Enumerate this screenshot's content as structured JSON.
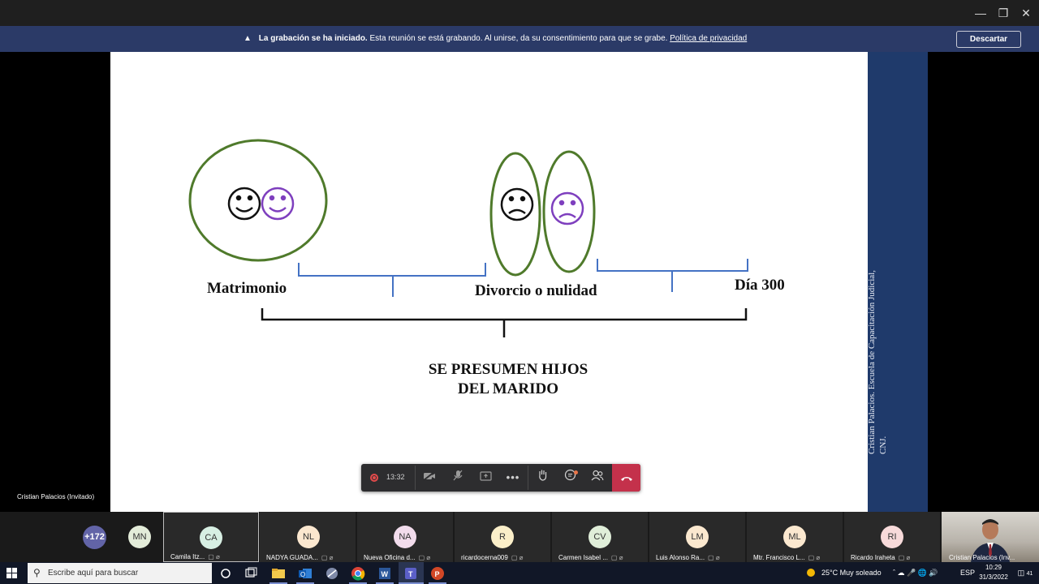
{
  "banner": {
    "title": "La grabación se ha iniciado.",
    "message": "Esta reunión se está grabando. Al unirse, da su consentimiento para que se grabe.",
    "link": "Política de privacidad",
    "dismiss": "Descartar"
  },
  "slide": {
    "label_marriage": "Matrimonio",
    "label_divorce": "Divorcio o nulidad",
    "label_day": "Día 300",
    "conclusion_line1": "SE PRESUMEN HIJOS",
    "conclusion_line2": "DEL MARIDO",
    "side_line1": "Cristian Palacios. Escuela de Capacitación Judicial,",
    "side_line2": "CNJ."
  },
  "presenter_label": "Cristian Palacios (Invitado)",
  "controls": {
    "timer": "13:32"
  },
  "participants": {
    "overflow": "+172",
    "tiles": [
      {
        "initials": "MN",
        "name": "",
        "color": "#e3ecd9"
      },
      {
        "initials": "CA",
        "name": "Camila Itz...",
        "color": "#d7efe3"
      },
      {
        "initials": "NL",
        "name": "NADYA GUADA...",
        "color": "#fbe7cf"
      },
      {
        "initials": "NA",
        "name": "Nueva Oficina d...",
        "color": "#f2dcec"
      },
      {
        "initials": "R",
        "name": "ricardocerna009",
        "color": "#fbefc9"
      },
      {
        "initials": "CV",
        "name": "Carmen Isabel ...",
        "color": "#e0eed9"
      },
      {
        "initials": "LM",
        "name": "Luis Alonso Ra...",
        "color": "#fbe8cf"
      },
      {
        "initials": "ML",
        "name": "Mtr. Francisco L...",
        "color": "#fbe8cf"
      },
      {
        "initials": "RI",
        "name": "Ricardo Iraheta",
        "color": "#f7dada"
      }
    ],
    "video_name": "Cristian Palacios (Inv..."
  },
  "taskbar": {
    "search_placeholder": "Escribe aquí para buscar",
    "weather": "25°C  Muy soleado",
    "lang": "ESP",
    "time": "10:29",
    "date": "31/3/2022",
    "notifications": "41"
  }
}
